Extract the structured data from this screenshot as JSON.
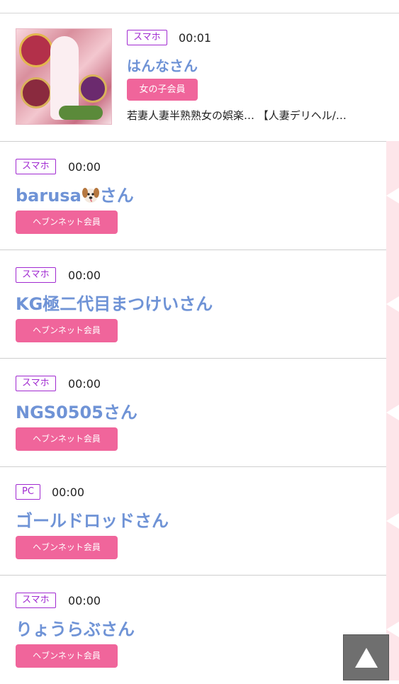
{
  "featured": {
    "device": "スマホ",
    "time": "00:01",
    "name": "はんなさん",
    "badge": "女の子会員",
    "description": "若妻人妻半熟熟女の娯楽… 【人妻デリヘル/…"
  },
  "entries": [
    {
      "device": "スマホ",
      "time": "00:00",
      "name": "barusa",
      "name_suffix": "さん",
      "badge": "ヘブンネット会員"
    },
    {
      "device": "スマホ",
      "time": "00:00",
      "name": "KG極二代目まつけいさん",
      "badge": "ヘブンネット会員"
    },
    {
      "device": "スマホ",
      "time": "00:00",
      "name": "NGS0505さん",
      "badge": "ヘブンネット会員"
    },
    {
      "device": "PC",
      "time": "00:00",
      "name": "ゴールドロッドさん",
      "badge": "ヘブンネット会員"
    },
    {
      "device": "スマホ",
      "time": "00:00",
      "name": "りょうらぶさん",
      "badge": "ヘブンネット会員"
    }
  ],
  "colors": {
    "device_tag": "#a12ad1",
    "name": "#6f93d6",
    "badge": "#f0659b",
    "strip": "#fde6ea"
  },
  "icons": {
    "emoji_after_barusa": "dog-face-icon",
    "scroll_button": "triangle-up-icon"
  }
}
